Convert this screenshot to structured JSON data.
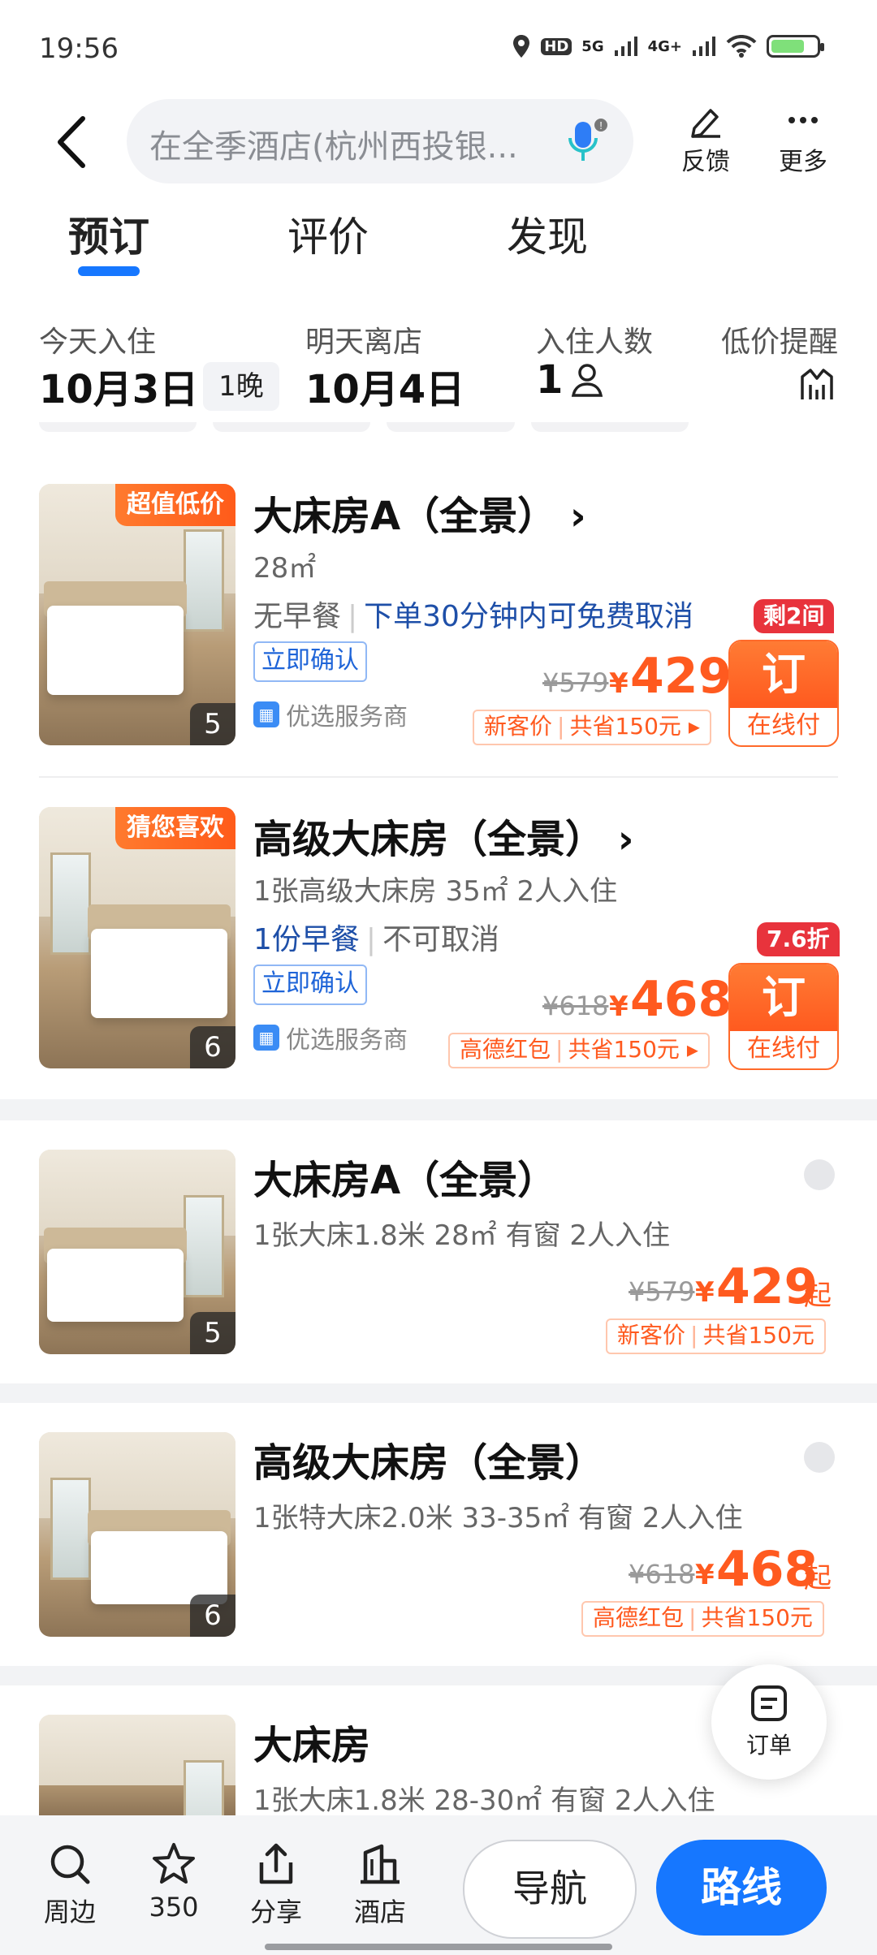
{
  "status_bar": {
    "time": "19:56",
    "hd": "HD",
    "net1": "5G",
    "net2": "4G+"
  },
  "header": {
    "search_placeholder": "在全季酒店(杭州西投银...",
    "feedback": "反馈",
    "more": "更多"
  },
  "tabs": [
    {
      "label": "预订",
      "active": true
    },
    {
      "label": "评价"
    },
    {
      "label": "发现"
    }
  ],
  "booking": {
    "checkin_label": "今天入住",
    "checkin_date": "10月3日",
    "nights": "1晚",
    "checkout_label": "明天离店",
    "checkout_date": "10月4日",
    "guests_label": "入住人数",
    "guests": "1",
    "alert_label": "低价提醒"
  },
  "rooms": [
    {
      "tag": "超值低价",
      "photo_count": "5",
      "title": "大床房A（全景）",
      "area": "28㎡",
      "meal": "无早餐",
      "cancel": "下单30分钟内可免费取消",
      "confirm": "立即确认",
      "provider": "优选服务商",
      "orig_price": "¥579",
      "yen": "¥",
      "price": "429",
      "promo1": "新客价",
      "promo2": "共省150元",
      "promo_arrow": "▸",
      "badge": "剩2间",
      "book": "订",
      "pay": "在线付"
    },
    {
      "tag": "猜您喜欢",
      "photo_count": "6",
      "title": "高级大床房（全景）",
      "spec": "1张高级大床房  35㎡  2人入住",
      "meal": "1份早餐",
      "cancel": "不可取消",
      "confirm": "立即确认",
      "provider": "优选服务商",
      "orig_price": "¥618",
      "yen": "¥",
      "price": "468",
      "promo1": "高德红包",
      "promo2": "共省150元",
      "promo_arrow": "▸",
      "badge": "7.6折",
      "book": "订",
      "pay": "在线付"
    },
    {
      "photo_count": "5",
      "title": "大床房A（全景）",
      "spec": "1张大床1.8米  28㎡  有窗  2人入住",
      "orig_price": "¥579",
      "yen": "¥",
      "price": "429",
      "qi": "起",
      "promo1": "新客价",
      "promo2": "共省150元"
    },
    {
      "photo_count": "6",
      "title": "高级大床房（全景）",
      "spec": "1张特大床2.0米  33-35㎡  有窗  2人入住",
      "orig_price": "¥618",
      "yen": "¥",
      "price": "468",
      "qi": "起",
      "promo1": "高德红包",
      "promo2": "共省150元"
    },
    {
      "title": "大床房",
      "spec": "1张大床1.8米  28-30㎡  有窗  2人入住"
    }
  ],
  "order_fab": {
    "label": "订单"
  },
  "bottom_bar": {
    "nearby": "周边",
    "favorites": "350",
    "share": "分享",
    "hotel": "酒店",
    "navigate": "导航",
    "route": "路线"
  }
}
